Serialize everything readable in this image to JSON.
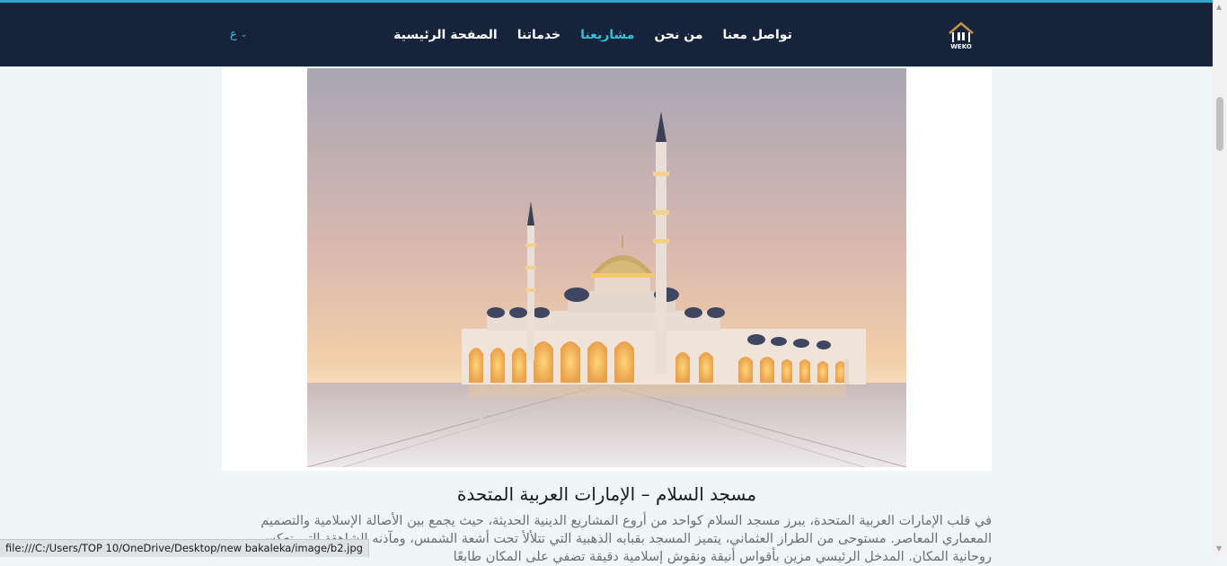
{
  "nav": {
    "items": [
      {
        "label": "الصفحة الرئيسية",
        "active": false
      },
      {
        "label": "خدماتنا",
        "active": false
      },
      {
        "label": "مشاريعنا",
        "active": true
      },
      {
        "label": "من نحن",
        "active": false
      },
      {
        "label": "تواصل معنا",
        "active": false
      }
    ],
    "language": "ع",
    "logo_text": "WEKO",
    "logo_icon": "building-logo-icon",
    "chevron_icon": "chevron-down-icon"
  },
  "project": {
    "title": "مسجد السلام – الإمارات العربية المتحدة",
    "description": "في قلب الإمارات العربية المتحدة، يبرز مسجد السلام كواحد من أروع المشاريع الدينية الحديثة، حيث يجمع بين الأصالة الإسلامية والتصميم المعماري المعاصر. مستوحى من الطراز العثماني، يتميز المسجد بقبابه الذهبية التي تتلألأ تحت أشعة الشمس، ومآذنه الشاهقة التي تعكس روحانية المكان. المدخل الرئيسي مزين بأقواس أنيقة ونقوش إسلامية دقيقة تضفي على المكان طابعًا"
  },
  "status_bar": {
    "url": "file:///C:/Users/TOP 10/OneDrive/Desktop/new bakaleka/image/b2.jpg"
  },
  "colors": {
    "navbar": "#16233a",
    "accent": "#2ec4d6",
    "page_bg": "#eef6f8"
  }
}
